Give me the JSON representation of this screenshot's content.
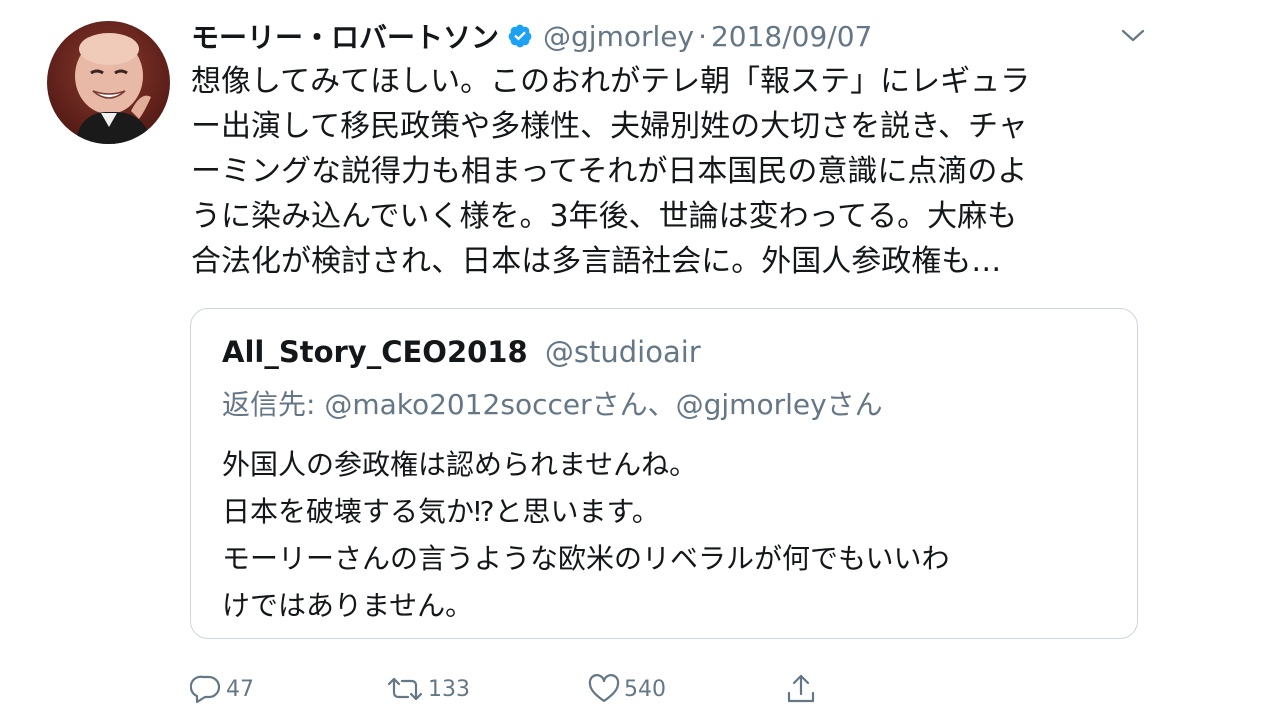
{
  "tweet": {
    "display_name": "モーリー・ロバートソン",
    "verified": true,
    "handle": "@gjmorley",
    "separator": "·",
    "date": "2018/09/07",
    "text_lines": [
      "想像してみてほしい。このおれがテレ朝「報ステ」にレギュラ",
      "ー出演して移民政策や多様性、夫婦別姓の大切さを説き、チャ",
      "ーミングな説得力も相まってそれが日本国民の意識に点滴のよ",
      "うに染み込んでいく様を。3年後、世論は変わってる。大麻も",
      "合法化が検討され、日本は多言語社会に。外国人参政権も…"
    ]
  },
  "quoted_tweet": {
    "display_name": "All_Story_CEO2018",
    "handle": "@studioair",
    "reply_to": "返信先: @mako2012soccerさん、@gjmorleyさん",
    "text_lines": [
      "外国人の参政権は認められませんね。",
      "日本を破壊する気か⁉と思います。",
      "モーリーさんの言うような欧米のリベラルが何でもいいわ",
      "けではありません。"
    ]
  },
  "actions": {
    "reply_count": "47",
    "retweet_count": "133",
    "like_count": "540"
  },
  "icons": {
    "verified": "verified-badge-icon",
    "caret": "chevron-down-icon",
    "reply": "reply-icon",
    "retweet": "retweet-icon",
    "like": "heart-icon",
    "share": "share-icon"
  },
  "colors": {
    "text": "#14171a",
    "secondary": "#657786",
    "verified_blue": "#1da1f2",
    "card_border": "#ccd6dd"
  }
}
